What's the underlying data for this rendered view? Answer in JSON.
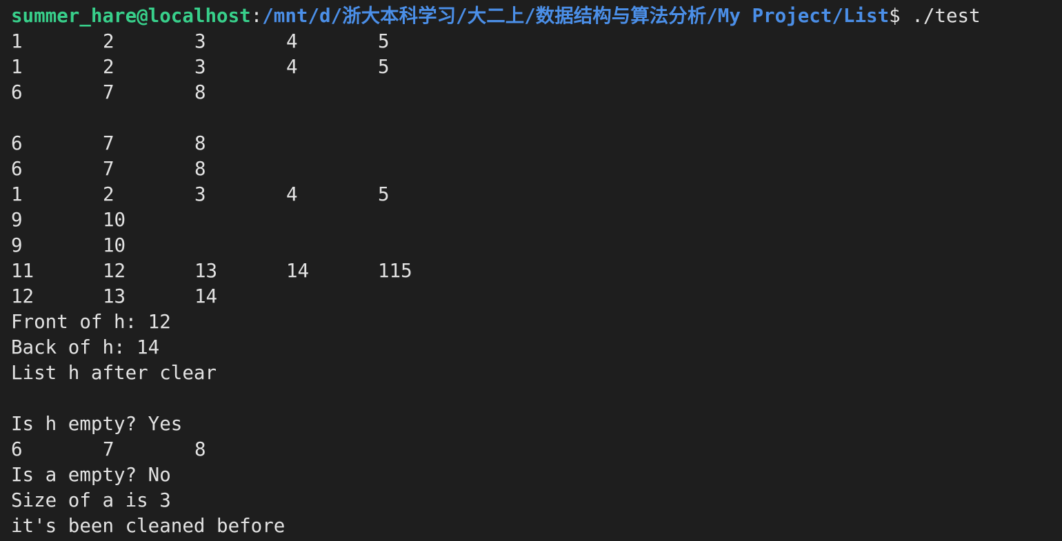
{
  "prompt": {
    "user_host": "summer_hare@localhost",
    "colon": ":",
    "path": "/mnt/d/浙大本科学习/大二上/数据结构与算法分析/My Project/List",
    "dollar": "$",
    "command": " ./test"
  },
  "output": [
    [
      "1",
      "2",
      "3",
      "4",
      "5"
    ],
    [
      "1",
      "2",
      "3",
      "4",
      "5"
    ],
    [
      "6",
      "7",
      "8"
    ],
    [],
    [
      "6",
      "7",
      "8"
    ],
    [
      "6",
      "7",
      "8"
    ],
    [
      "1",
      "2",
      "3",
      "4",
      "5"
    ],
    [
      "9",
      "10"
    ],
    [
      "9",
      "10"
    ],
    [
      "11",
      "12",
      "13",
      "14",
      "115"
    ],
    [
      "12",
      "13",
      "14"
    ],
    [
      "Front of h: 12"
    ],
    [
      "Back of h: 14"
    ],
    [
      "List h after clear"
    ],
    [],
    [
      "Is h empty? Yes"
    ],
    [
      "6",
      "7",
      "8"
    ],
    [
      "Is a empty? No"
    ],
    [
      "Size of a is 3"
    ],
    [
      "it's been cleaned before"
    ]
  ]
}
